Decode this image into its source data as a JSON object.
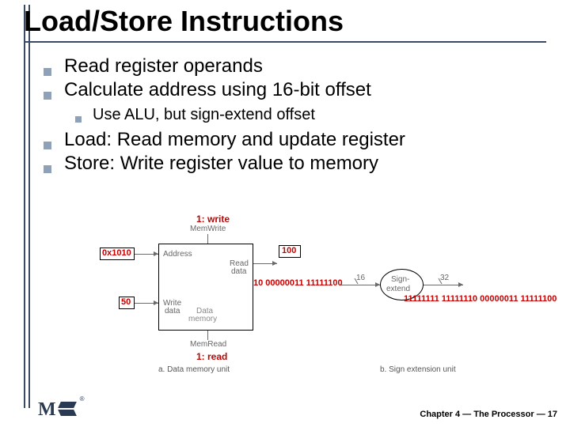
{
  "title": "Load/Store Instructions",
  "bullets": {
    "b1": "Read register operands",
    "b2": "Calculate address using 16-bit offset",
    "b2a": "Use ALU, but sign-extend offset",
    "b3": "Load: Read memory and update register",
    "b4": "Store: Write register value to memory"
  },
  "diagram": {
    "write_lbl": "1: write",
    "memwrite": "MemWrite",
    "address": "Address",
    "read_data": "Read",
    "read_data2": "data",
    "write_data": "Write",
    "write_data2": "data",
    "data_memory": "Data",
    "data_memory2": "memory",
    "memread": "MemRead",
    "read_lbl": "1: read",
    "addr_val": "0x1010",
    "rdata_val": "100",
    "wdata_val": "50",
    "binary_in": "10 00000011 11111100",
    "binary_out": "11111111 11111110 00000011 11111100",
    "sixteen": "16",
    "thirtytwo": "32",
    "sign_ext1": "Sign-",
    "sign_ext2": "extend",
    "cap_a": "a. Data memory unit",
    "cap_b": "b. Sign extension unit"
  },
  "footer": {
    "chapter": "Chapter 4 — The Processor — 17"
  },
  "logo": {
    "reg": "®"
  }
}
